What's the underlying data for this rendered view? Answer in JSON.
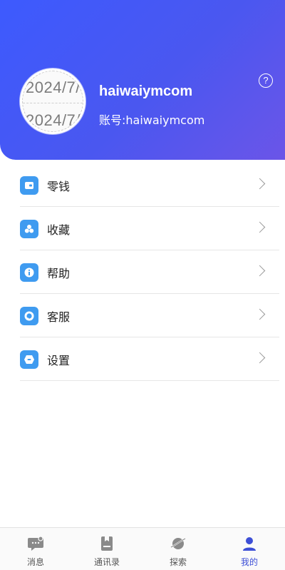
{
  "profile": {
    "avatar_text_1": "2024/7/",
    "avatar_text_2": "2024/7/",
    "username": "haiwaiymcom",
    "account": "账号:haiwaiymcom",
    "help_symbol": "?"
  },
  "menu": {
    "items": [
      {
        "label": "零钱",
        "icon": "wallet-icon"
      },
      {
        "label": "收藏",
        "icon": "favorites-icon"
      },
      {
        "label": "帮助",
        "icon": "info-icon"
      },
      {
        "label": "客服",
        "icon": "customer-service-icon"
      },
      {
        "label": "设置",
        "icon": "settings-icon"
      }
    ]
  },
  "tabbar": {
    "items": [
      {
        "label": "消息",
        "icon": "chat-bubble-icon"
      },
      {
        "label": "通讯录",
        "icon": "contacts-book-icon"
      },
      {
        "label": "探索",
        "icon": "planet-icon"
      },
      {
        "label": "我的",
        "icon": "person-icon",
        "active": true
      }
    ]
  },
  "colors": {
    "header_start": "#3d5afe",
    "header_end": "#6b55e8",
    "menu_icon": "#3f9bf0",
    "tab_active": "#3d4fd6",
    "tab_inactive": "#8a8a8a"
  }
}
